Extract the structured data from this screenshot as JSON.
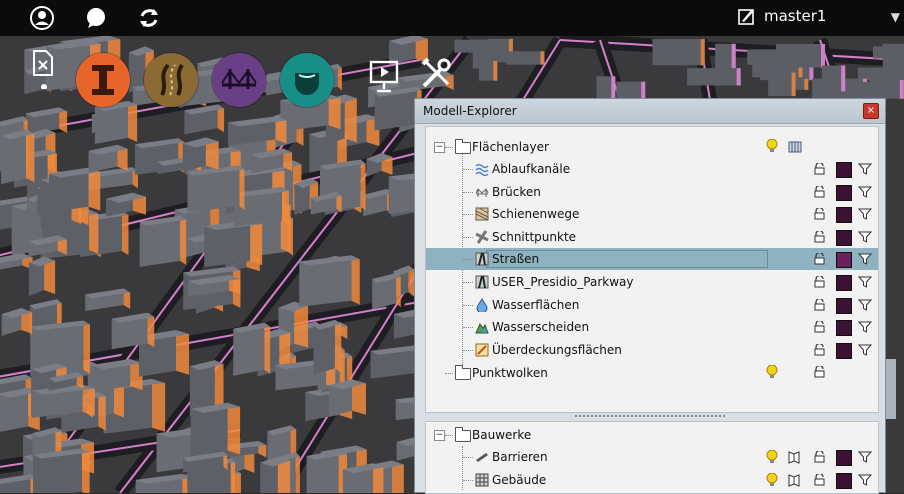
{
  "topbar": {
    "icons": [
      "user-icon",
      "chat-icon",
      "sync-icon"
    ],
    "branch_label": "master1",
    "branch_icon": "branch-edit-icon",
    "menu_icon": "caret-down-icon"
  },
  "tools": {
    "small_left": "document-settings-icon",
    "round_buttons": [
      {
        "name": "infrastructure-button",
        "icon": "i-beam-icon",
        "color": "#e8632a"
      },
      {
        "name": "roads-button",
        "icon": "road-icon",
        "color": "#8c6a34"
      },
      {
        "name": "bridges-button",
        "icon": "bridge-icon",
        "color": "#6a3f86"
      },
      {
        "name": "water-button",
        "icon": "water-drop-icon",
        "color": "#178f87"
      }
    ],
    "right_icons": [
      "presentation-icon",
      "tools-icon"
    ]
  },
  "panel": {
    "title": "Modell-Explorer",
    "close_icon": "close-icon"
  },
  "tree": {
    "group1": {
      "label": "Flächenlayer",
      "expander": "⊟"
    },
    "items": [
      {
        "label": "Ablaufkanäle",
        "icon": "wave-icon"
      },
      {
        "label": "Brücken",
        "icon": "bridge-small-icon"
      },
      {
        "label": "Schienenwege",
        "icon": "rail-icon"
      },
      {
        "label": "Schnittpunkte",
        "icon": "junction-icon"
      },
      {
        "label": "Straßen",
        "icon": "road-layer-icon",
        "selected": true
      },
      {
        "label": "USER_Presidio_Parkway",
        "icon": "road-layer-icon"
      },
      {
        "label": "Wasserflächen",
        "icon": "water-drop-small-icon"
      },
      {
        "label": "Wasserscheiden",
        "icon": "watershed-icon"
      },
      {
        "label": "Überdeckungsflächen",
        "icon": "coverage-icon"
      }
    ],
    "group2": {
      "label": "Punktwolken"
    },
    "lower": {
      "group": {
        "label": "Bauwerke",
        "expander": "⊟"
      },
      "items": [
        {
          "label": "Barrieren",
          "icon": "barrier-icon"
        },
        {
          "label": "Gebäude",
          "icon": "building-icon"
        }
      ]
    }
  },
  "colors": {
    "layer_swatch": "#3c1133",
    "selected_swatch": "#6a1f5c",
    "road_highlight": "#e88be0",
    "building_face": "#f08a3c"
  }
}
